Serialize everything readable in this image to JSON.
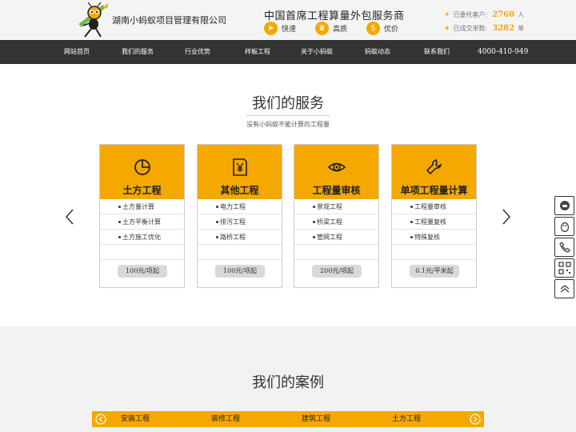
{
  "header": {
    "company": "湖南小蚂蚁项目管理有限公司",
    "slogan": "中国首席工程算量外包服务商",
    "features": [
      {
        "icon": "running-person-icon",
        "label": "快速"
      },
      {
        "icon": "trophy-icon",
        "label": "高质"
      },
      {
        "icon": "coin-icon",
        "label": "优价"
      }
    ],
    "stats": [
      {
        "label": "已委托客户:",
        "value": "2760",
        "unit": "人"
      },
      {
        "label": "已成交单数:",
        "value": "3282",
        "unit": "单"
      }
    ]
  },
  "nav": {
    "items": [
      "网站首页",
      "我们的服务",
      "行业优势",
      "样板工程",
      "关于小蚂蚁",
      "蚂蚁动态",
      "联系我们"
    ],
    "phone": "4000-410-949"
  },
  "services": {
    "title": "我们的服务",
    "subtitle": "没有小蚂蚁不能计算的工程量",
    "cards": [
      {
        "icon": "pie-chart-icon",
        "title": "土方工程",
        "items": [
          "土方量计算",
          "土方平衡计算",
          "土方施工优化"
        ],
        "price": "100元/项起"
      },
      {
        "icon": "yen-document-icon",
        "title": "其他工程",
        "items": [
          "电力工程",
          "排污工程",
          "路桥工程"
        ],
        "price": "100元/项起"
      },
      {
        "icon": "eye-icon",
        "title": "工程量审核",
        "items": [
          "景观工程",
          "桥梁工程",
          "管网工程"
        ],
        "price": "200元/项起"
      },
      {
        "icon": "wrench-icon",
        "title": "单项工程量计算",
        "items": [
          "工程量审核",
          "工程量复核",
          "特殊复核"
        ],
        "price": "0.1元/平米起"
      }
    ]
  },
  "cases": {
    "title": "我们的案例",
    "tabs": [
      "安装工程",
      "装修工程",
      "建筑工程",
      "土方工程"
    ]
  },
  "side_tools": [
    "customer-service-icon",
    "qq-penguin-icon",
    "phone-icon",
    "qr-code-icon",
    "back-to-top-icon"
  ],
  "colors": {
    "accent": "#f5a800",
    "nav_bg": "#333333"
  }
}
